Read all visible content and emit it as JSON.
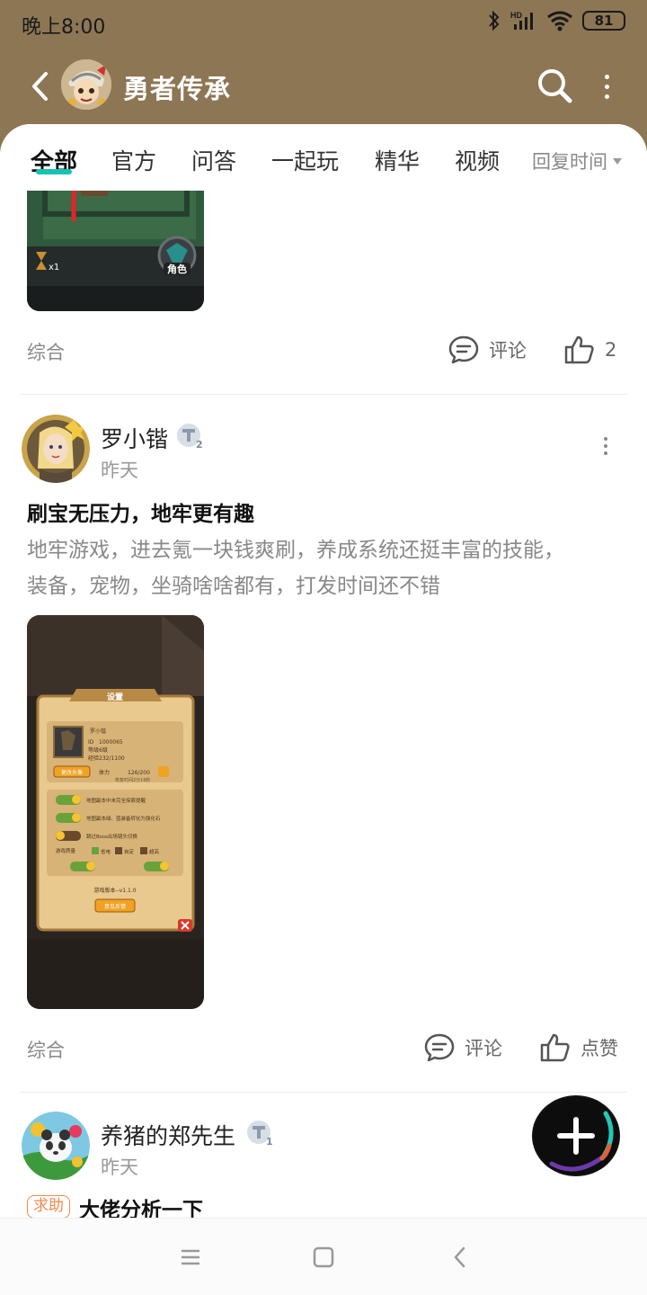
{
  "status_bar": {
    "time": "晚上8:00",
    "battery": "81",
    "network": "HD"
  },
  "header": {
    "title": "勇者传承",
    "back_icon": "chevron-left-icon",
    "search_icon": "search-icon",
    "more_icon": "more-vertical-icon"
  },
  "tabs": [
    {
      "label": "全部",
      "active": true
    },
    {
      "label": "官方"
    },
    {
      "label": "问答"
    },
    {
      "label": "一起玩"
    },
    {
      "label": "精华"
    },
    {
      "label": "视频"
    }
  ],
  "sort": {
    "label": "回复时间"
  },
  "colors": {
    "header_bg": "#8d7654",
    "accent": "#16c3b3",
    "tag_orange": "#f08a4c"
  },
  "posts": [
    {
      "category": "综合",
      "comment_label": "评论",
      "like_label": "2"
    },
    {
      "author": "罗小锴",
      "level": "2",
      "time": "昨天",
      "title": "刷宝无压力，地牢更有趣",
      "body_line1": "地牢游戏，进去氪一块钱爽刷，养成系统还挺丰富的技能，",
      "body_line2": "装备，宠物，坐骑啥啥都有，打发时间还不错",
      "image": {
        "dialog_title": "设置",
        "player_name": "罗小锴",
        "id_label": "ID",
        "id_value": "1000065",
        "level_label": "等级",
        "level_value": "6级",
        "exp_label": "经验",
        "exp_value": "232/1100",
        "edit_avatar": "更改头像",
        "stamina_label": "体力",
        "stamina_value": "126/200",
        "recover_text": "恢复时间2分16秒",
        "opt1": "地图副本中未完全探索提醒",
        "opt2": "地图副本绿、蓝装备转化为强化石",
        "opt3": "跳过Boss出场镜头切换",
        "quality_label": "游戏质量",
        "q1": "省电",
        "q2": "自定",
        "q3": "超高",
        "version": "游戏版本--v1.1.0",
        "feedback": "意见反馈"
      },
      "category": "综合",
      "comment_label": "评论",
      "like_label": "点赞"
    },
    {
      "author": "养猪的郑先生",
      "level": "1",
      "time": "昨天",
      "tag": "求助",
      "title": "大佬分析一下"
    }
  ],
  "first_image": {
    "role_label": "角色",
    "speed_label": "x1"
  },
  "fab": {
    "icon": "plus-icon"
  },
  "nav": {
    "menu_icon": "menu-icon",
    "home_icon": "square-icon",
    "back_icon": "triangle-back-icon"
  }
}
